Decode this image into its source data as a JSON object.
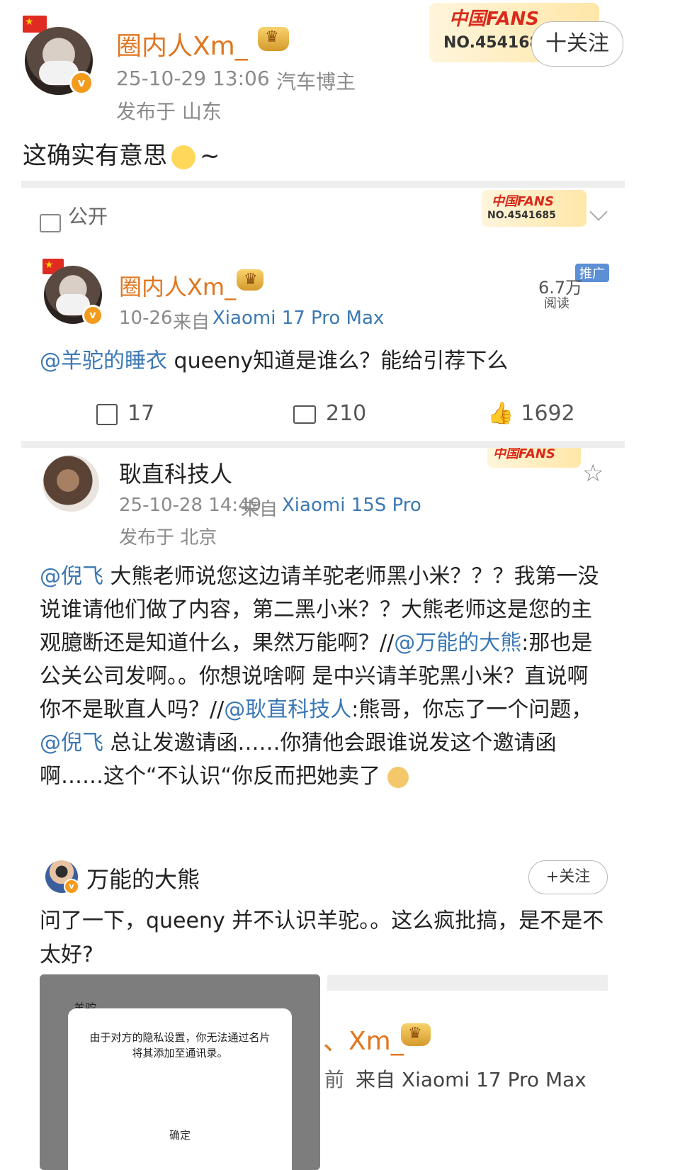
{
  "post": {
    "author": "圈内人Xm_",
    "timestamp": "25-10-29 13:06",
    "role": "汽车博主",
    "location": "发布于 山东",
    "content": "这确实有意思",
    "content_suffix": "~",
    "fans_badge": {
      "title": "中国FANS",
      "number": "NO.454168"
    },
    "follow_label": "十关注",
    "visibility": "公开"
  },
  "quoted_card": {
    "fans_badge": {
      "title": "中国FANS",
      "number": "NO.4541685"
    },
    "author": "圈内人Xm_",
    "date": "10-26",
    "source_prefix": "来自",
    "source_device": "Xiaomi 17 Pro Max",
    "read_count": "6.7万",
    "read_label": "阅读",
    "promo_tag": "推广",
    "mention": "@羊驼的睡衣",
    "content": " queeny知道是谁么？能给引荐下么",
    "reposts": "17",
    "comments": "210",
    "likes": "1692"
  },
  "repost": {
    "fans_badge_title": "中国FANS",
    "author": "耿直科技人",
    "timestamp": "25-10-28 14:49",
    "source_prefix": "来自",
    "source_device": "Xiaomi 15S Pro",
    "location": "发布于 北京",
    "segments": [
      {
        "text": "@倪飞",
        "type": "link"
      },
      {
        "text": " 大熊老师说您这边请羊驼老师黑小米？？？我第一没说谁请他们做了内容，第二黑小米？？大熊老师这是您的主观臆断还是知道什么，果然万能啊？//",
        "type": "text"
      },
      {
        "text": "@万能的大熊",
        "type": "link"
      },
      {
        "text": ":那也是公关公司发啊。。你想说啥啊 是中兴请羊驼黑小米？直说啊 你不是耿直人吗？//",
        "type": "text"
      },
      {
        "text": "@耿直科技人",
        "type": "link"
      },
      {
        "text": ":熊哥，你忘了一个问题，",
        "type": "text"
      },
      {
        "text": "@倪飞",
        "type": "link"
      },
      {
        "text": " 总让发邀请函……你猜他会跟谁说发这个邀请函啊……这个“不认识“你反而把她卖了",
        "type": "text"
      }
    ]
  },
  "nested_post": {
    "author": "万能的大熊",
    "follow_label": "+关注",
    "content": "问了一下，queeny 并不认识羊驼。。这么疯批搞，是不是不太好?",
    "screenshot_title": "羊驼",
    "dialog_text": "由于对方的隐私设置，你无法通过名片将其添加至通讯录。",
    "dialog_button": "确定",
    "partial_author": "、Xm_",
    "partial_time": "前",
    "partial_source": "来自 Xiaomi 17 Pro Max"
  },
  "colors": {
    "orange": "#e0761f",
    "link": "#3b78b4",
    "grey": "#8a8a8a"
  }
}
